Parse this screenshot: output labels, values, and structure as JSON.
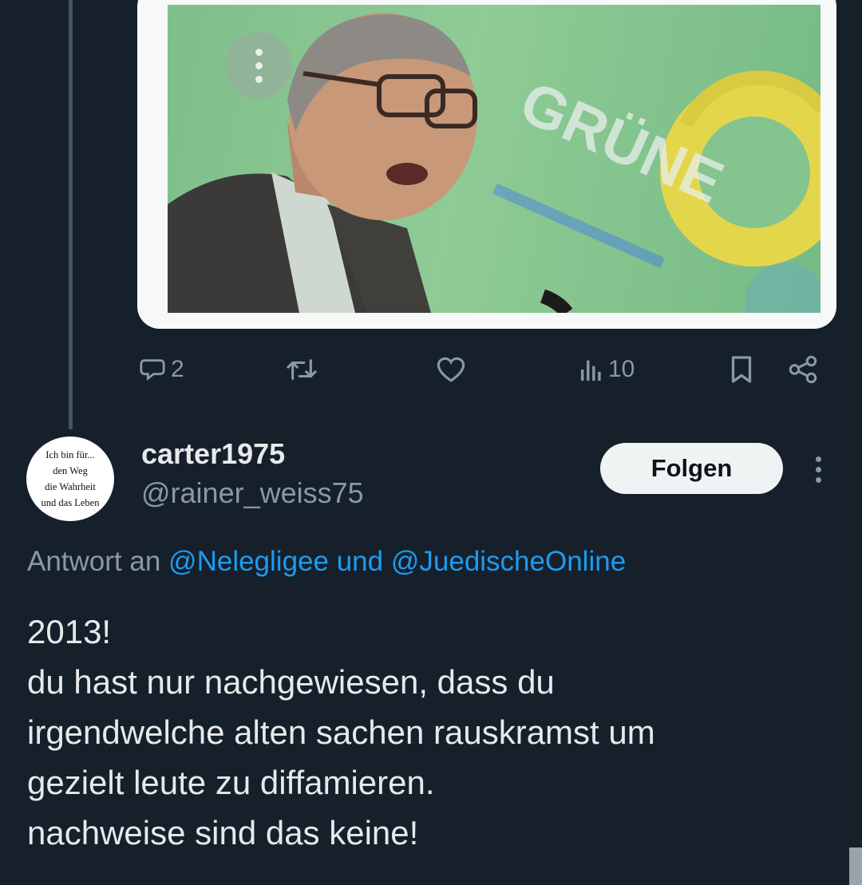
{
  "colors": {
    "background": "#15202b",
    "primary_text": "#e7e9ea",
    "secondary_text": "#8b98a5",
    "mention": "#1d9bf0",
    "follow_button_bg": "#eff3f4"
  },
  "media": {
    "poster_text": "GRÜNE",
    "menu_icon": "more-vertical-icon"
  },
  "action_bar": {
    "reply_count": "2",
    "repost_count": "",
    "like_count": "",
    "view_count": "10",
    "icons": [
      "reply-icon",
      "repost-icon",
      "like-icon",
      "views-icon",
      "bookmark-icon",
      "share-icon"
    ]
  },
  "reply_tweet": {
    "avatar_text": "Ich bin für...\nden Weg\ndie Wahrheit\nund das Leben",
    "display_name": "carter1975",
    "handle": "@rainer_weiss75",
    "follow_label": "Folgen",
    "replying_prefix": "Antwort an",
    "replying_to_1": "@Nelegligee",
    "replying_joiner": "und",
    "replying_to_2": "@JuedischeOnline",
    "text_lines": [
      "2013!",
      "du hast nur nachgewiesen, dass du",
      "irgendwelche alten sachen rauskramst um",
      "gezielt leute zu diffamieren.",
      "nachweise sind das keine!"
    ]
  }
}
